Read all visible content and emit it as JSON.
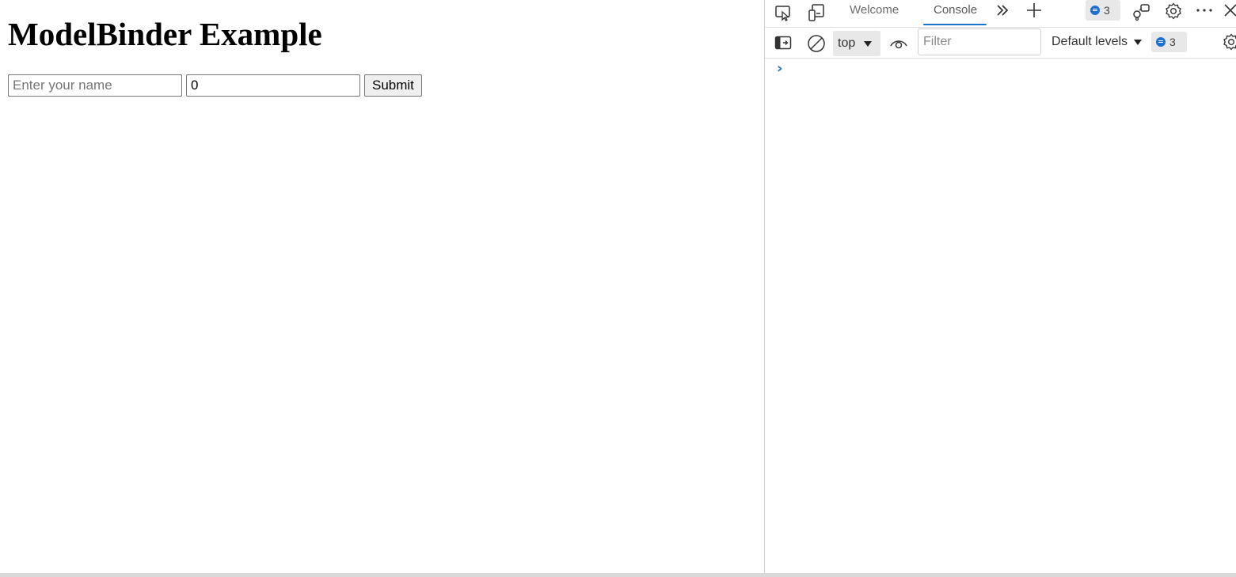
{
  "page": {
    "title": "ModelBinder Example",
    "name_input": {
      "placeholder": "Enter your name",
      "value": ""
    },
    "number_input": {
      "value": "0"
    },
    "submit_label": "Submit"
  },
  "devtools": {
    "tabs": [
      {
        "label": "Welcome",
        "active": false
      },
      {
        "label": "Console",
        "active": true
      }
    ],
    "issues_count": "3",
    "console_toolbar": {
      "context": "top",
      "filter_placeholder": "Filter",
      "levels_label": "Default levels",
      "issues_count": "3"
    },
    "prompt": "›"
  },
  "colors": {
    "accent": "#1a73c8",
    "badge_bg": "#e8e8e8",
    "issue_dot": "#1f6fd1"
  },
  "icons": [
    "inspect-element-icon",
    "device-emulation-icon",
    "more-tabs-icon",
    "add-tab-icon",
    "issues-icon",
    "dock-icon",
    "settings-icon",
    "more-options-icon",
    "close-icon",
    "toggle-sidebar-icon",
    "clear-console-icon",
    "live-expression-eye-icon",
    "console-settings-icon"
  ]
}
